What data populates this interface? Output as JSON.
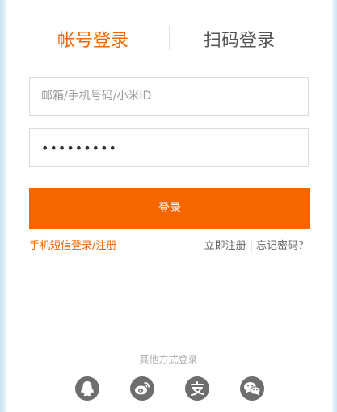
{
  "tabs": {
    "account_login": "帐号登录",
    "qr_login": "扫码登录"
  },
  "form": {
    "username_placeholder": "邮箱/手机号码/小米ID",
    "password_value": "•••••••••",
    "login_button": "登录"
  },
  "links": {
    "sms_login_register": "手机短信登录/注册",
    "register_now": "立即注册",
    "separator": "|",
    "forgot_password": "忘记密码？"
  },
  "other_login": {
    "label": "其他方式登录",
    "providers": [
      "qq-icon",
      "weibo-icon",
      "alipay-icon",
      "wechat-icon"
    ]
  },
  "colors": {
    "accent": "#f56600",
    "icon_bg": "#6e6e6e"
  }
}
